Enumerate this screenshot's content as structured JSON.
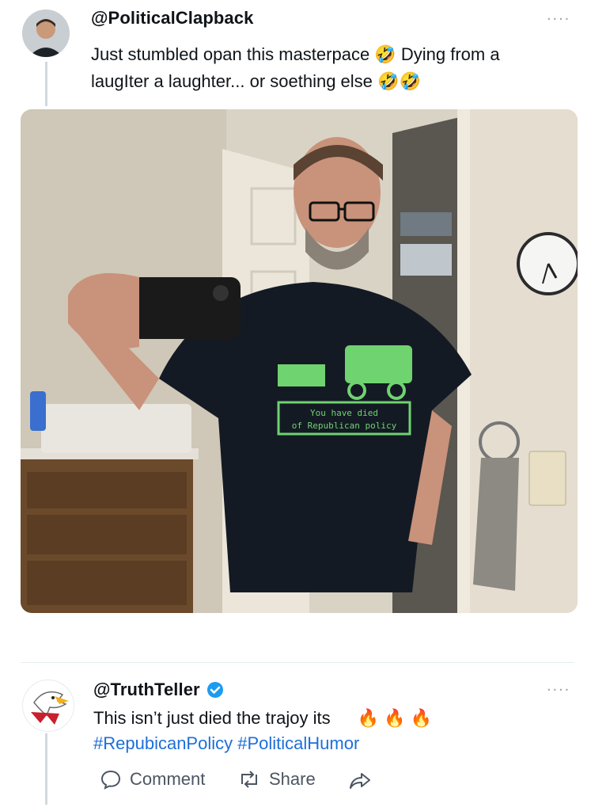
{
  "post": {
    "handle": "@PoliticalClapback",
    "text": "Just stumbled opan this masterpace",
    "text_after_emoji": "Dying from a",
    "line2": "laugIter a laughter... or soething else",
    "more": "....",
    "image": {
      "shirt_line1": "You have died",
      "shirt_line2": "of Republican policy"
    }
  },
  "reply": {
    "handle": "@TruthTeller",
    "verified": true,
    "text": "This isn’t just died the trajoy its",
    "hashtags": "#RepubicanPolicy #PoliticalHumor",
    "more": "....",
    "actions": {
      "comment": "Comment",
      "share": "Share"
    }
  },
  "colors": {
    "link": "#1d6fd8",
    "verified": "#1d9bf0",
    "muted": "#4b5563",
    "shirt_print": "#6fd36f"
  },
  "icons": [
    "laughing-emoji-icon",
    "fire-icon",
    "comment-icon",
    "retweet-icon",
    "share-arrow-icon",
    "verified-badge-icon"
  ]
}
